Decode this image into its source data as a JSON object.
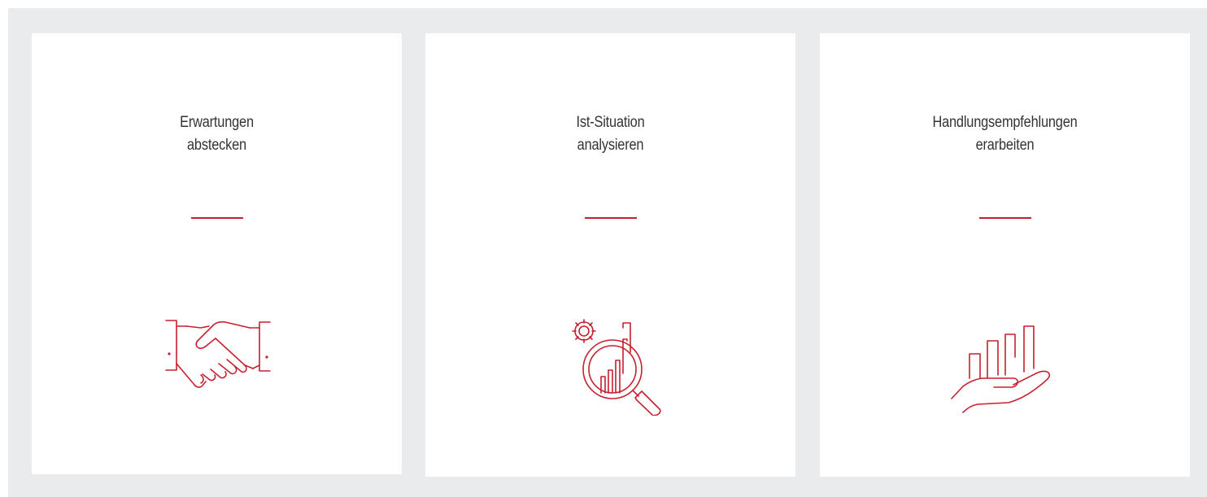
{
  "colors": {
    "accent": "#c6202e",
    "background": "#eaebed",
    "card": "#ffffff",
    "text": "#333333"
  },
  "cards": [
    {
      "title": "Erwartungen\nabstecken",
      "icon": "handshake-icon"
    },
    {
      "title": "Ist-Situation\nanalysieren",
      "icon": "magnifier-chart-gear-icon"
    },
    {
      "title": "Handlungsempfehlungen\nerarbeiten",
      "icon": "hand-bar-chart-icon"
    }
  ]
}
